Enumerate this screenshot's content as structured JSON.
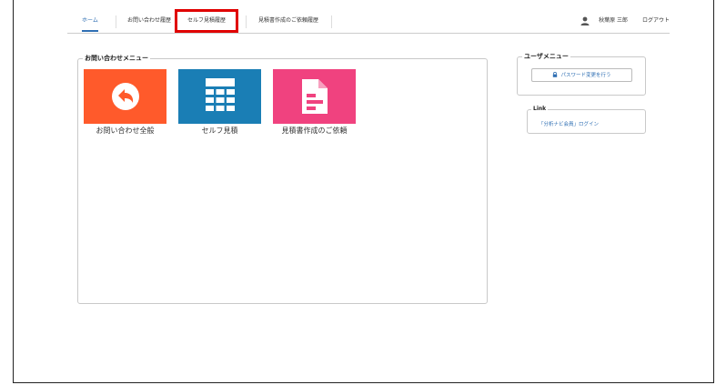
{
  "nav": {
    "tabs": [
      {
        "label": "ホーム"
      },
      {
        "label": "お問い合わせ履歴"
      },
      {
        "label": "セルフ見積履歴"
      },
      {
        "label": "見積書作成のご依頼履歴"
      }
    ],
    "user_name": "秋葉原 三郎",
    "logout_label": "ログアウト"
  },
  "inquiry_menu": {
    "title": "お問い合わせメニュー",
    "tiles": [
      {
        "label": "お問い合わせ全般",
        "color": "#ff5a2b",
        "icon": "reply-icon"
      },
      {
        "label": "セルフ見積",
        "color": "#1a7eb5",
        "icon": "calculator-icon"
      },
      {
        "label": "見積書作成のご依頼",
        "color": "#f0427f",
        "icon": "document-icon"
      }
    ]
  },
  "user_menu": {
    "title": "ユーザメニュー",
    "password_button": "パスワード変更を行う"
  },
  "links": {
    "title": "Link",
    "login_link": "「分析ナビ会員」ログイン"
  },
  "colors": {
    "accent": "#2f6fb3",
    "highlight": "#e00000"
  }
}
